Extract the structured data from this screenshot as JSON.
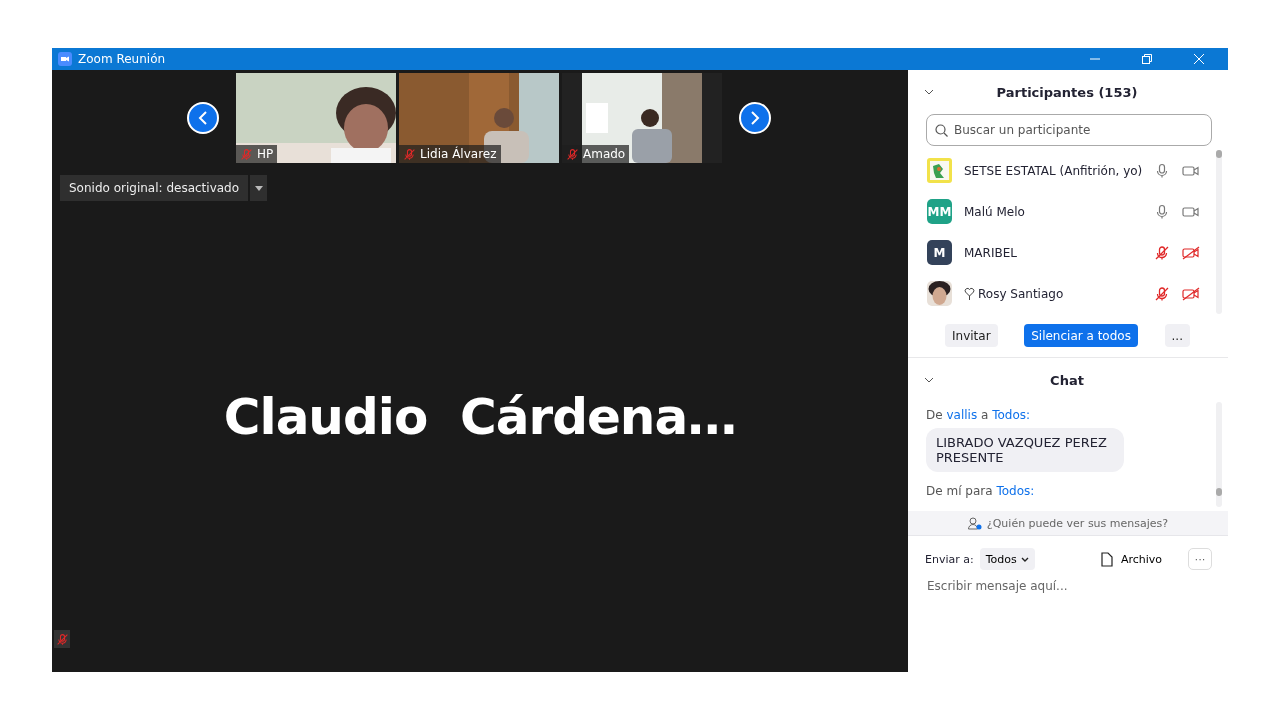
{
  "window": {
    "title": "Zoom Reunión"
  },
  "video_strip": {
    "tiles": [
      {
        "name": "HP",
        "muted": true,
        "kind": "picture"
      },
      {
        "name": "Lidia Álvarez",
        "muted": true,
        "kind": "picture"
      },
      {
        "name": "Amado",
        "muted": true,
        "kind": "picture"
      }
    ]
  },
  "sound_button": {
    "label": "Sonido original: desactivado"
  },
  "active_speaker": {
    "name": "Claudio  Cárdena…",
    "muted": true
  },
  "participants": {
    "title": "Participantes (153)",
    "search": {
      "placeholder": "Buscar un participante"
    },
    "items": [
      {
        "name": "SETSE ESTATAL (Anfitrión, yo)",
        "kind": "logo",
        "audio_muted": false,
        "video_muted": false,
        "marker": false
      },
      {
        "name": "Malú Melo",
        "kind": "initials",
        "initials": "MM",
        "color": "#1fa287",
        "audio_muted": false,
        "video_muted": false,
        "marker": false
      },
      {
        "name": "MARIBEL",
        "kind": "initials",
        "initials": "M",
        "color": "#33425a",
        "audio_muted": true,
        "video_muted": true,
        "marker": false
      },
      {
        "name": "Rosy Santiago",
        "audio_muted": true,
        "video_muted": true,
        "marker": true
      }
    ],
    "buttons": [
      {
        "label": "Invitar",
        "kind": "plain"
      },
      {
        "label": "Silenciar a todos",
        "kind": "primary"
      },
      {
        "label": "...",
        "kind": "plain"
      }
    ]
  },
  "chat": {
    "title": "Chat",
    "messages": [
      {
        "lead": "De",
        "sender": "vallis",
        "joiner": "a",
        "recipient": "Todos:",
        "text": "LIBRADO VAZQUEZ PEREZ PRESENTE"
      },
      {
        "lead": "De mí para",
        "recipient": "Todos:"
      }
    ],
    "notice": "¿Quién puede ver sus mensajes?",
    "send_to_label": "Enviar a:",
    "send_to": "Todos",
    "file": "Archivo",
    "more": "···",
    "input": {
      "placeholder": "Escribir mensaje aquí..."
    }
  }
}
